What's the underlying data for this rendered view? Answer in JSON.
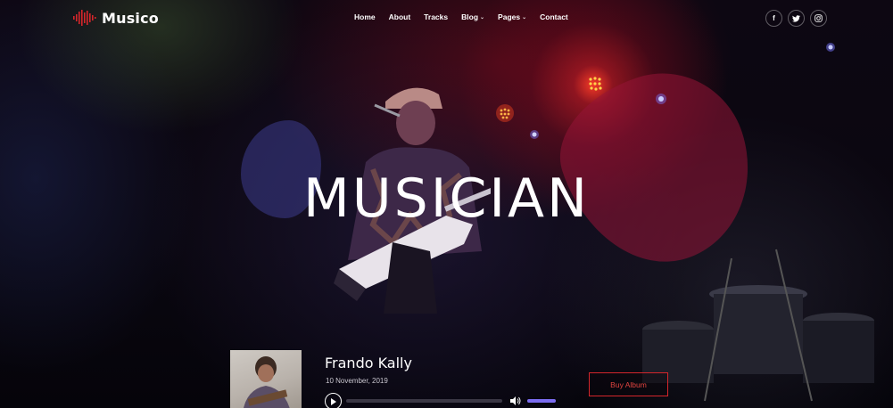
{
  "brand": {
    "name": "Musico",
    "accent": "#d4262b"
  },
  "nav": {
    "items": [
      {
        "label": "Home",
        "dropdown": false
      },
      {
        "label": "About",
        "dropdown": false
      },
      {
        "label": "Tracks",
        "dropdown": false
      },
      {
        "label": "Blog",
        "dropdown": true
      },
      {
        "label": "Pages",
        "dropdown": true
      },
      {
        "label": "Contact",
        "dropdown": false
      }
    ]
  },
  "social": [
    {
      "icon": "facebook-icon",
      "glyph": "f"
    },
    {
      "icon": "twitter-icon",
      "glyph": "t"
    },
    {
      "icon": "instagram-icon",
      "glyph": "◎"
    }
  ],
  "hero": {
    "title": "MUSICIAN"
  },
  "player": {
    "track_name": "Frando Kally",
    "date": "10 November, 2019",
    "progress": 0.0,
    "volume": 1.0,
    "buy_label": "Buy Album",
    "volume_color": "#7b6cf0"
  }
}
